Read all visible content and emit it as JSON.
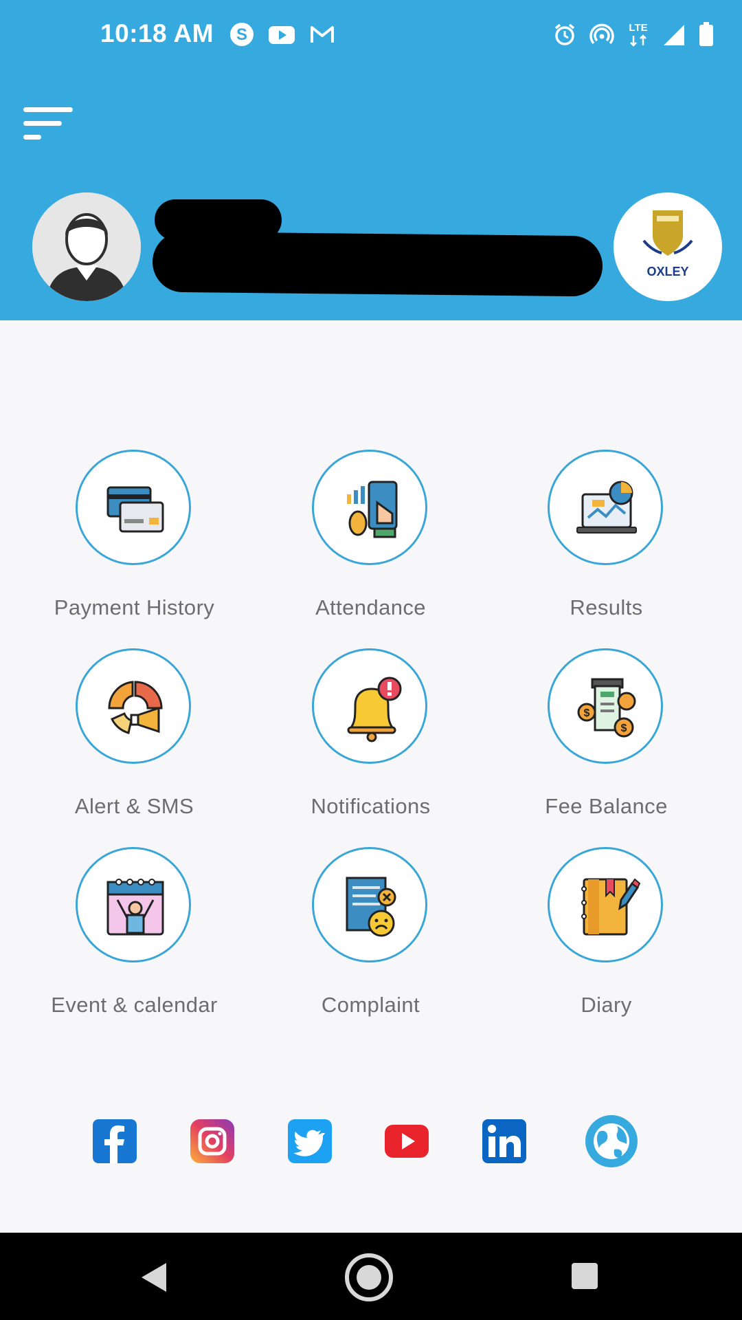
{
  "status_bar": {
    "time": "10:18 AM",
    "left_icons": [
      "skype-icon",
      "youtube-icon",
      "gmail-icon"
    ],
    "right_icons": [
      "alarm-icon",
      "hotspot-icon",
      "lte-icon",
      "signal-icon",
      "battery-icon"
    ],
    "network": "LTE"
  },
  "header": {
    "menu_icon": "menu-icon",
    "school_name": "OXLEY",
    "colors": {
      "header_bg": "#36a9df",
      "accent": "#39a6d7"
    }
  },
  "menu": [
    {
      "label": "Payment History",
      "icon": "payment-history-icon"
    },
    {
      "label": "Attendance",
      "icon": "attendance-icon"
    },
    {
      "label": "Results",
      "icon": "results-icon"
    },
    {
      "label": "Alert & SMS",
      "icon": "alert-sms-icon"
    },
    {
      "label": "Notifications",
      "icon": "notifications-icon"
    },
    {
      "label": "Fee Balance",
      "icon": "fee-balance-icon"
    },
    {
      "label": "Event & calendar",
      "icon": "event-calendar-icon"
    },
    {
      "label": "Complaint",
      "icon": "complaint-icon"
    },
    {
      "label": "Diary",
      "icon": "diary-icon"
    }
  ],
  "social": [
    "facebook-icon",
    "instagram-icon",
    "twitter-icon",
    "youtube-icon",
    "linkedin-icon",
    "globe-icon"
  ],
  "nav": [
    "back-icon",
    "home-icon",
    "recents-icon"
  ]
}
